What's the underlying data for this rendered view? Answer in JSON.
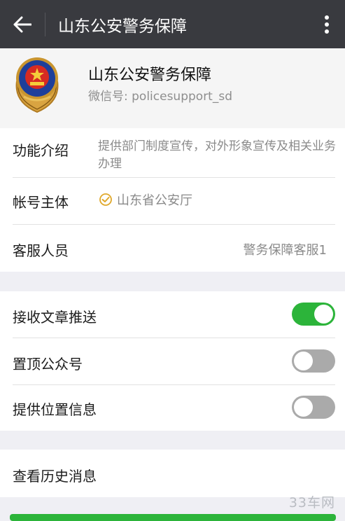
{
  "header": {
    "title": "山东公安警务保障",
    "back_icon": "arrow-left-icon",
    "more_icon": "more-vertical-icon"
  },
  "profile": {
    "name": "山东公安警务保障",
    "wechat_id": "微信号: policesupport_sd"
  },
  "info": {
    "intro_label": "功能介绍",
    "intro_text": "提供部门制度宣传，对外形象宣传及相关业务办理",
    "subject_label": "帐号主体",
    "subject_value": "山东省公安厅",
    "service_label": "客服人员",
    "service_value": "警务保障客服1"
  },
  "settings": [
    {
      "label": "接收文章推送",
      "enabled": true
    },
    {
      "label": "置顶公众号",
      "enabled": false
    },
    {
      "label": "提供位置信息",
      "enabled": false
    }
  ],
  "history": {
    "label": "查看历史消息"
  },
  "watermark": "33车网",
  "colors": {
    "topbar": "#393a3f",
    "toggle_on": "#2cb43a",
    "toggle_off": "#aaaaaa",
    "verified": "#e0a82a"
  }
}
